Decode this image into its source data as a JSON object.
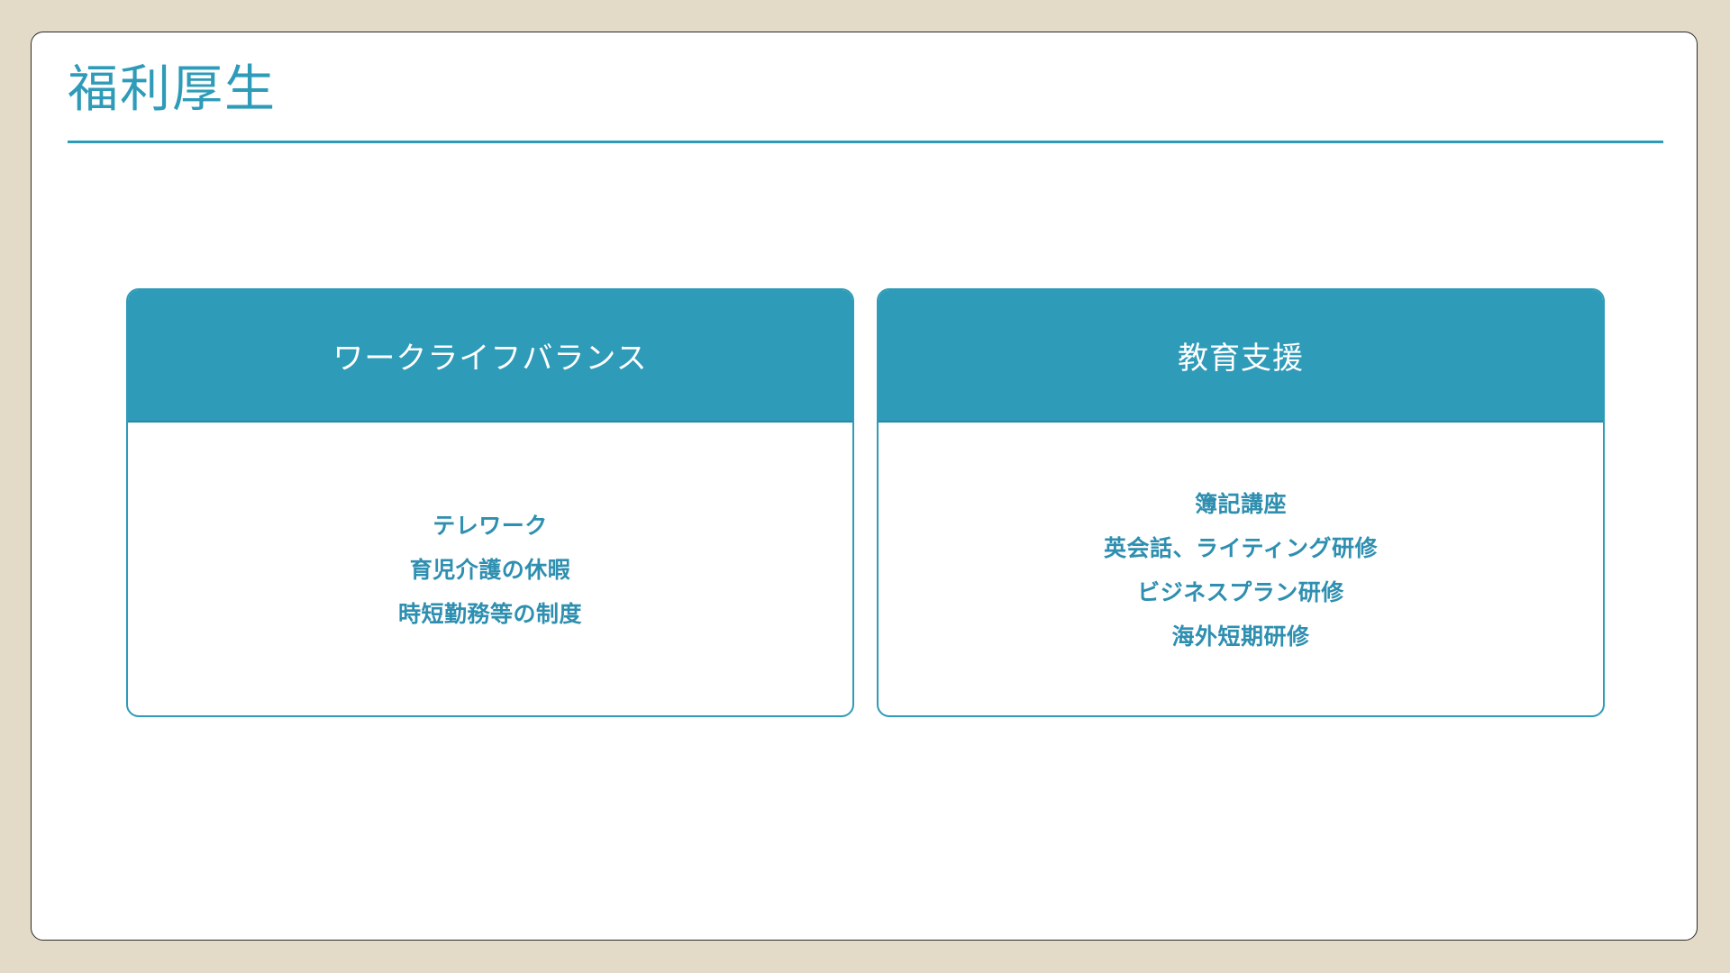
{
  "slide": {
    "title": "福利厚生"
  },
  "cards": [
    {
      "title": "ワークライフバランス",
      "items": [
        "テレワーク",
        "育児介護の休暇",
        "時短勤務等の制度"
      ]
    },
    {
      "title": "教育支援",
      "items": [
        "簿記講座",
        "英会話、ライティング研修",
        "ビジネスプラン研修",
        "海外短期研修"
      ]
    }
  ],
  "colors": {
    "accent": "#2e9bb8",
    "background": "#e3dbc8",
    "panel": "#ffffff"
  }
}
